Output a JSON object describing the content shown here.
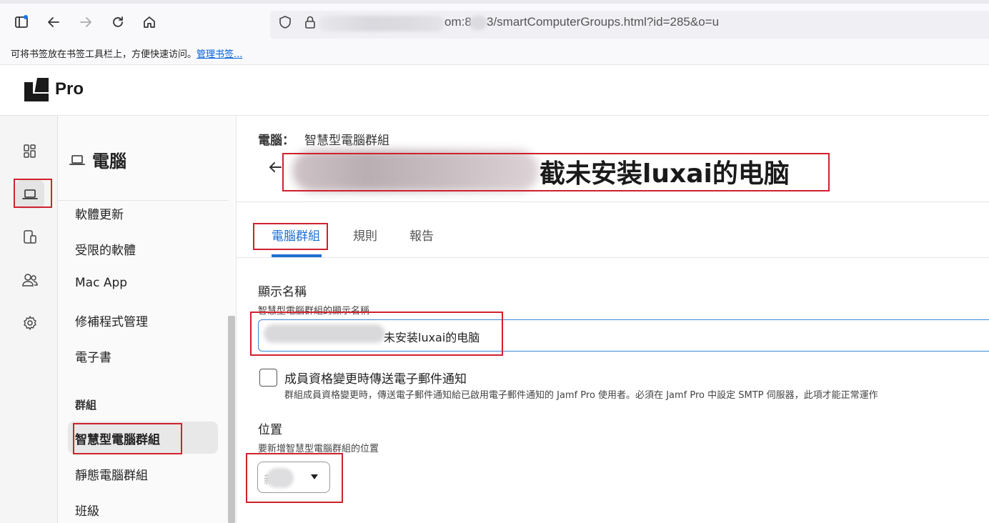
{
  "browser": {
    "url_visible_part1": "om:8",
    "url_visible_part2": "3/smartComputerGroups.html?id=285&o=u",
    "bookmarks_text": "可将书签放在书签工具栏上，方便快速访问。",
    "bookmarks_link": "管理书签..."
  },
  "app": {
    "logo_text": "Pro"
  },
  "subnav": {
    "title": "電腦",
    "items": [
      "軟體更新",
      "受限的軟體",
      "Mac App",
      "修補程式管理",
      "電子書"
    ],
    "section_label": "群組",
    "group_items": [
      "智慧型電腦群組",
      "靜態電腦群組",
      "班級"
    ]
  },
  "main": {
    "breadcrumb_parent": "電腦：",
    "breadcrumb_current": "智慧型電腦群組",
    "title_visible": "截未安装luxai的电脑",
    "tabs": [
      "電腦群組",
      "規則",
      "報告"
    ],
    "display_name_label": "顯示名稱",
    "display_name_help": "智慧型電腦群組的顯示名稱",
    "display_name_value_visible": "未安装luxai的电脑",
    "email_checkbox_label": "成員資格變更時傳送電子郵件通知",
    "email_checkbox_help": "群組成員資格變更時，傳送電子郵件通知給已啟用電子郵件通知的 Jamf Pro 使用者。必須在 Jamf Pro 中設定 SMTP 伺服器，此項才能正常運作",
    "email_checkbox_checked": false,
    "location_label": "位置",
    "location_help": "要新增智慧型電腦群組的位置",
    "location_value_visible": "新"
  },
  "colors": {
    "accent": "#1f6fd1",
    "annotation": "#d0212e"
  },
  "icons": {
    "rail": [
      "dashboard-icon",
      "laptop-icon",
      "mobile-devices-icon",
      "users-icon",
      "settings-icon"
    ]
  }
}
